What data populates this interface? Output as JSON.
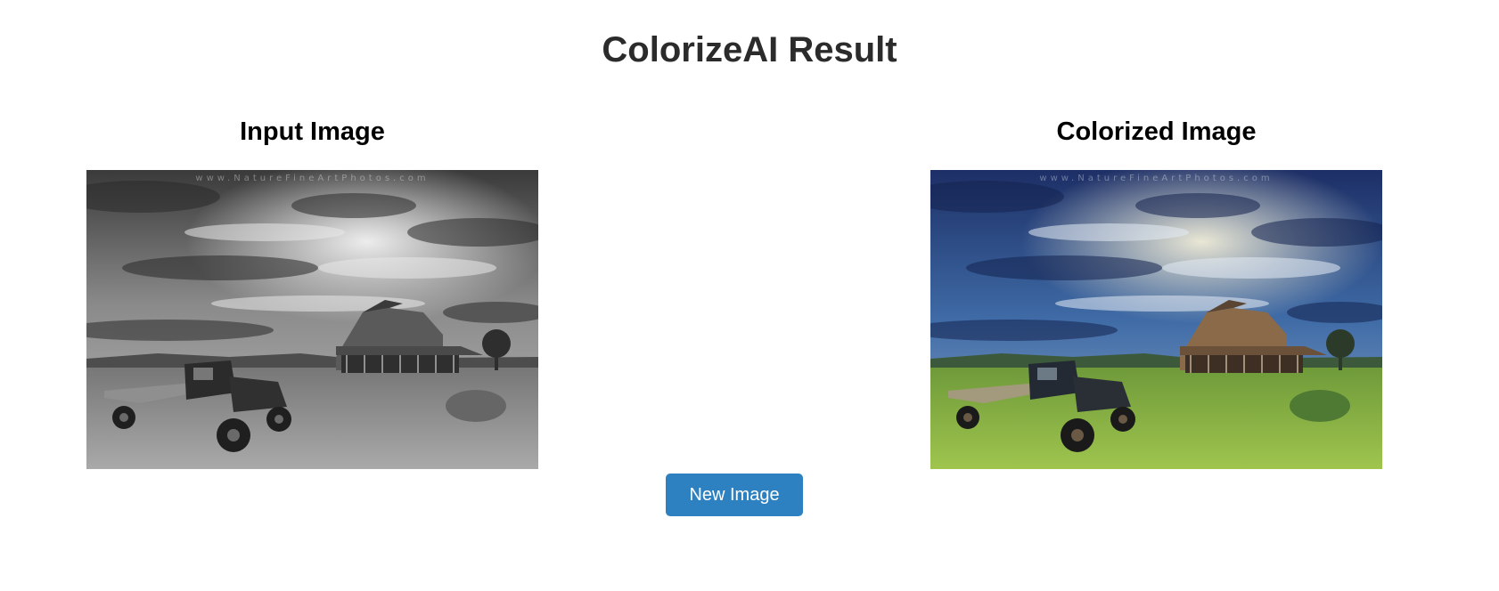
{
  "page": {
    "title": "ColorizeAI Result"
  },
  "input_panel": {
    "heading": "Input Image",
    "image_alt": "grayscale photo of an old truck in front of a wooden farmhouse under a cloudy sky",
    "watermark": "www.NatureFineArtPhotos.com"
  },
  "output_panel": {
    "heading": "Colorized Image",
    "image_alt": "colorized photo of an old truck in front of a wooden farmhouse under a blue cloudy sky with green grass",
    "watermark": "www.NatureFineArtPhotos.com"
  },
  "actions": {
    "new_image_label": "New Image"
  },
  "colors": {
    "button_bg": "#2e81c0",
    "title_text": "#2b2b2b"
  }
}
